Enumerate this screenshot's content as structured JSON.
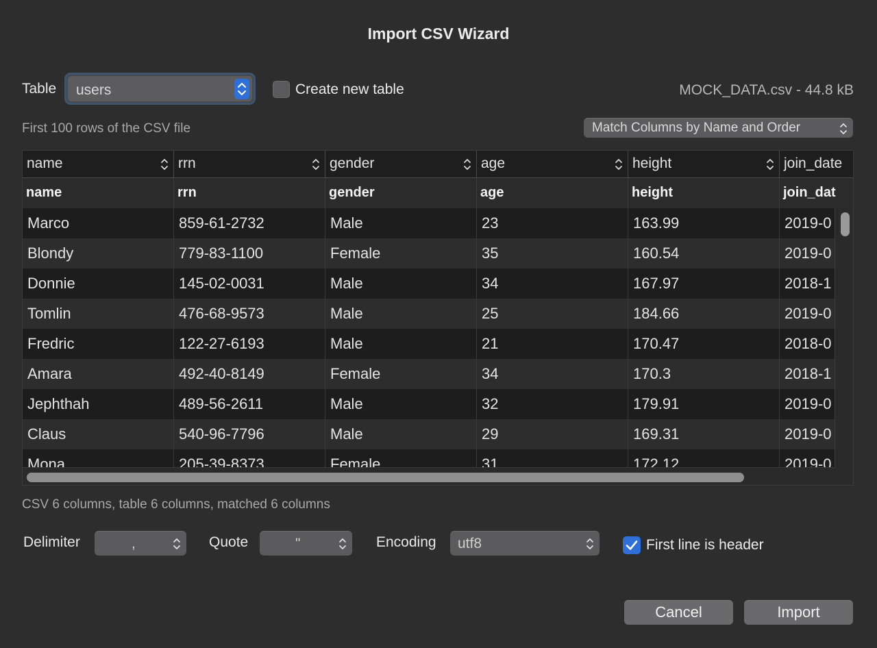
{
  "dialog": {
    "title": "Import CSV Wizard"
  },
  "target": {
    "label": "Table",
    "selected_table": "users",
    "create_new_label": "Create new table",
    "create_new_checked": false,
    "file_info": "MOCK_DATA.csv - 44.8 kB"
  },
  "preview": {
    "caption": "First 100 rows of the CSV file",
    "match_mode": "Match Columns by Name and Order",
    "mapping": [
      "name",
      "rrn",
      "gender",
      "age",
      "height",
      "join_date"
    ],
    "headers": [
      "name",
      "rrn",
      "gender",
      "age",
      "height",
      "join_dat"
    ],
    "rows": [
      [
        "Marco",
        "859-61-2732",
        "Male",
        "23",
        "163.99",
        "2019-0"
      ],
      [
        "Blondy",
        "779-83-1100",
        "Female",
        "35",
        "160.54",
        "2019-0"
      ],
      [
        "Donnie",
        "145-02-0031",
        "Male",
        "34",
        "167.97",
        "2018-1"
      ],
      [
        "Tomlin",
        "476-68-9573",
        "Male",
        "25",
        "184.66",
        "2019-0"
      ],
      [
        "Fredric",
        "122-27-6193",
        "Male",
        "21",
        "170.47",
        "2018-0"
      ],
      [
        "Amara",
        "492-40-8149",
        "Female",
        "34",
        "170.3",
        "2018-1"
      ],
      [
        "Jephthah",
        "489-56-2611",
        "Male",
        "32",
        "179.91",
        "2019-0"
      ],
      [
        "Claus",
        "540-96-7796",
        "Male",
        "29",
        "169.31",
        "2019-0"
      ],
      [
        "Mona",
        "205-39-8373",
        "Female",
        "31",
        "172.12",
        "2019-0"
      ]
    ],
    "summary": "CSV 6 columns, table 6 columns, matched 6 columns"
  },
  "options": {
    "delimiter_label": "Delimiter",
    "delimiter_value": ",",
    "quote_label": "Quote",
    "quote_value": "\"",
    "encoding_label": "Encoding",
    "encoding_value": "utf8",
    "first_line_header_label": "First line is header",
    "first_line_header_checked": true
  },
  "buttons": {
    "cancel": "Cancel",
    "import": "Import"
  },
  "colors": {
    "accent": "#2f6fd8",
    "background": "#2d2d2e"
  }
}
